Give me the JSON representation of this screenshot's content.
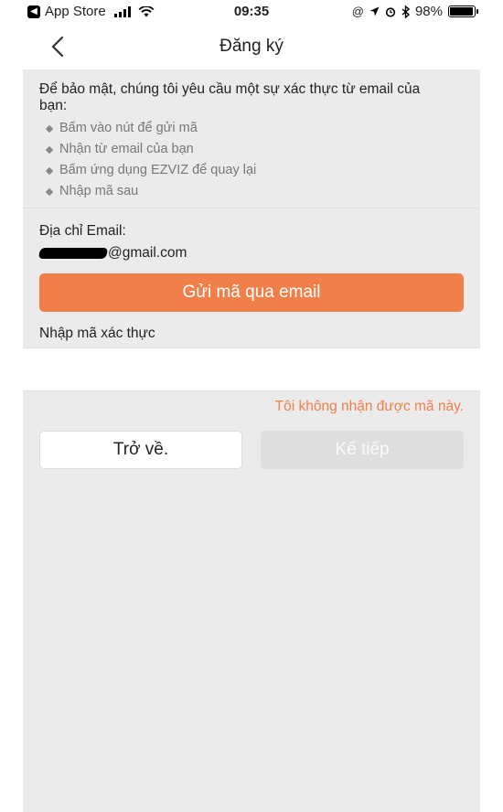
{
  "status_bar": {
    "back_app": "App Store",
    "time": "09:35",
    "battery": "98%",
    "battery_level": 0.98,
    "icons": [
      "back-arrow-icon",
      "signal-icon",
      "wifi-icon",
      "at-icon",
      "location-icon",
      "alarm-icon",
      "bluetooth-icon",
      "battery-icon"
    ]
  },
  "nav": {
    "title": "Đăng ký",
    "back_icon": "chevron-left-icon"
  },
  "info": {
    "text": "Để bảo mật, chúng tôi yêu cầu một sự xác thực từ email của bạn:",
    "bullets": [
      "Bấm vào nút để gửi mã",
      "Nhận từ email của bạn",
      "Bấm ứng dụng EZVIZ để quay lại",
      "Nhập mã sau"
    ]
  },
  "email": {
    "label": "Địa chỉ Email:",
    "value_suffix": "@gmail.com"
  },
  "send_button": "Gửi mã qua email",
  "code": {
    "label": "Nhập mã xác thực",
    "value": "",
    "placeholder": ""
  },
  "no_code_link": "Tôi không nhận được mã này.",
  "buttons": {
    "back": "Trở về.",
    "next": "Kế tiếp"
  },
  "colors": {
    "accent": "#f07f49",
    "panel_bg": "#ebebeb",
    "disabled_btn": "#dedede"
  }
}
